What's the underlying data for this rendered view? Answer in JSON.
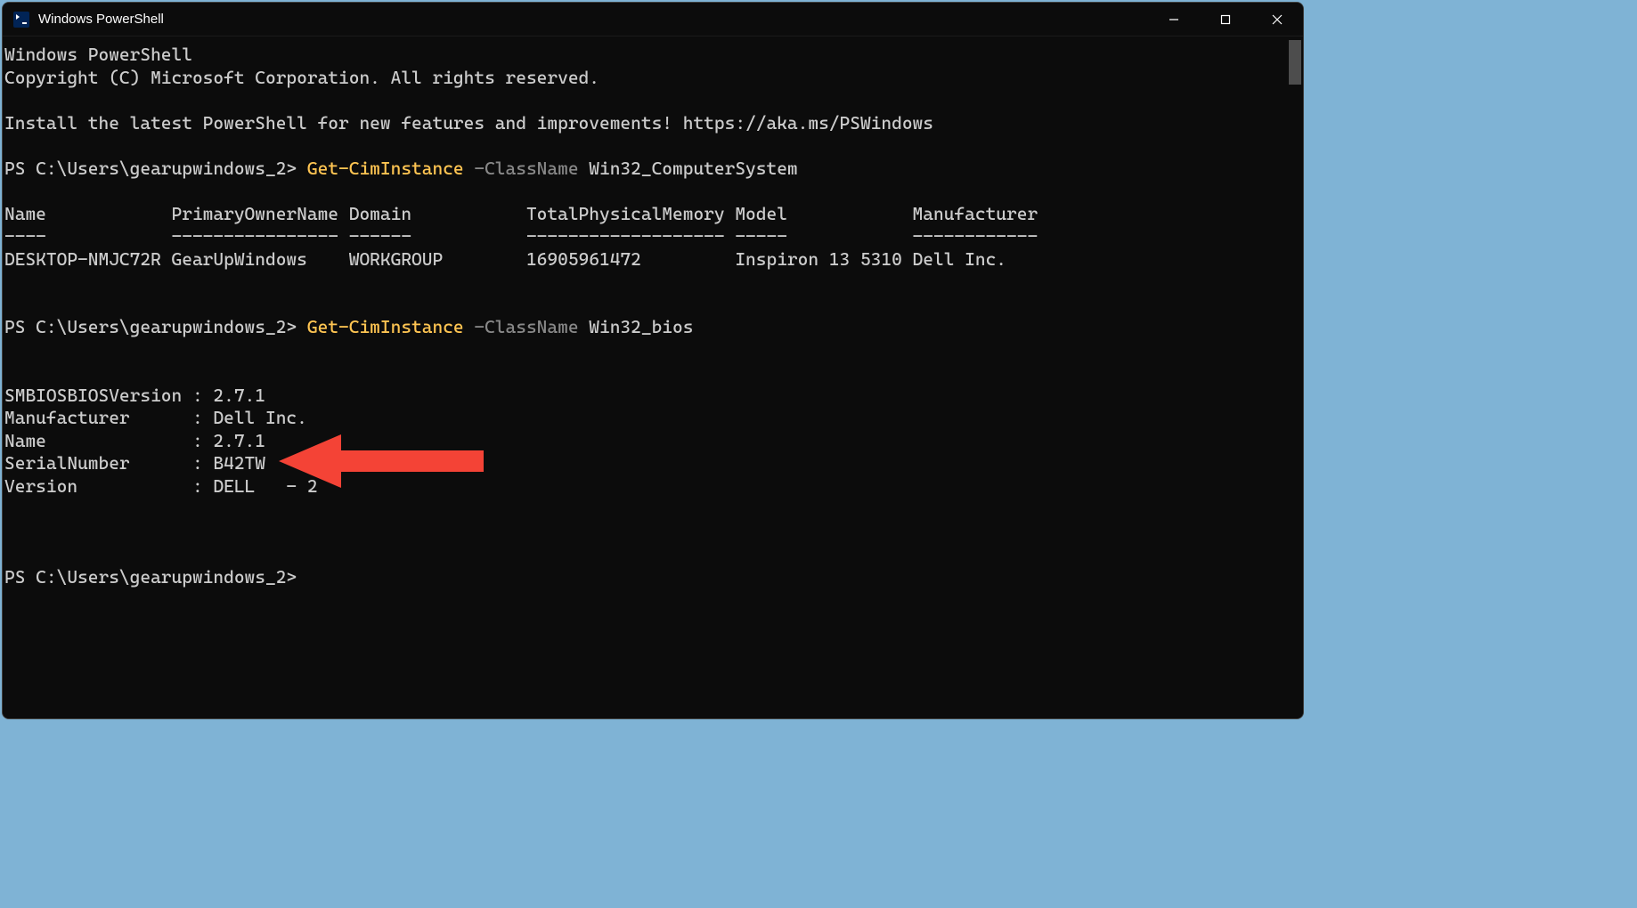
{
  "window": {
    "title": "Windows PowerShell"
  },
  "intro": {
    "line1": "Windows PowerShell",
    "line2": "Copyright (C) Microsoft Corporation. All rights reserved.",
    "line3": "Install the latest PowerShell for new features and improvements! https://aka.ms/PSWindows"
  },
  "cmd1": {
    "prompt": "PS C:\\Users\\gearupwindows_2> ",
    "cmdlet": "Get-CimInstance",
    "param": " -ClassName",
    "arg": " Win32_ComputerSystem"
  },
  "table1": {
    "headers": "Name            PrimaryOwnerName Domain           TotalPhysicalMemory Model            Manufacturer",
    "separators": "----            ---------------- ------           ------------------- -----            ------------",
    "row": "DESKTOP-NMJC72R GearUpWindows    WORKGROUP        16905961472         Inspiron 13 5310 Dell Inc."
  },
  "cmd2": {
    "prompt": "PS C:\\Users\\gearupwindows_2> ",
    "cmdlet": "Get-CimInstance",
    "param": " -ClassName",
    "arg": " Win32_bios"
  },
  "bios": {
    "l1": "SMBIOSBIOSVersion : 2.7.1",
    "l2": "Manufacturer      : Dell Inc.",
    "l3": "Name              : 2.7.1",
    "l4": "SerialNumber      : B42TW",
    "l5": "Version           : DELL   - 2"
  },
  "cmd3": {
    "prompt": "PS C:\\Users\\gearupwindows_2>"
  },
  "annotation": {
    "arrow_color": "#f44336"
  }
}
